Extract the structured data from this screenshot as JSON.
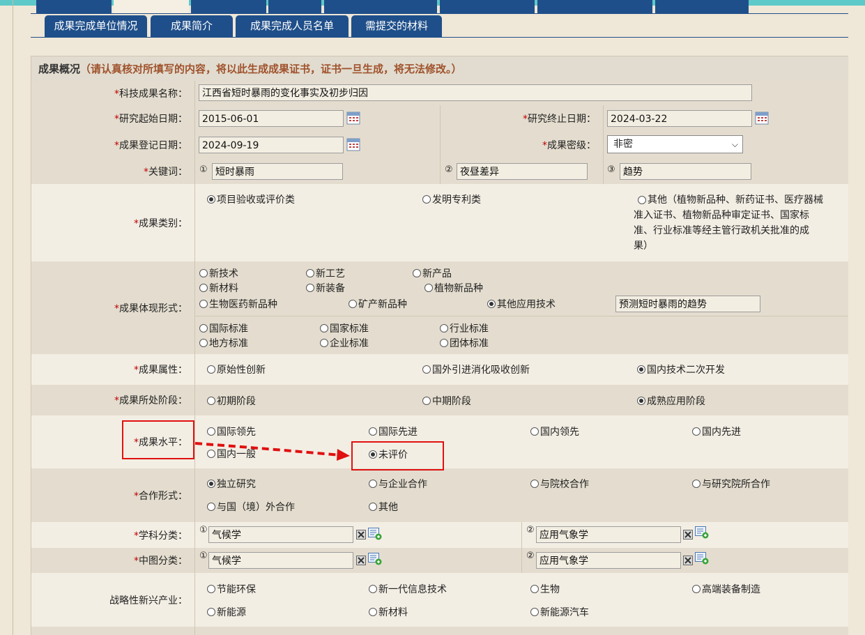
{
  "colors": {
    "tab_blue": "#1f4f8a",
    "accent_red": "#e01010",
    "warning_brown": "#a0522d",
    "top_strip": "#5ec9c9"
  },
  "sub_tabs": [
    {
      "label": "成果完成单位情况"
    },
    {
      "label": "成果简介"
    },
    {
      "label": "成果完成人员名单"
    },
    {
      "label": "需提交的材料"
    }
  ],
  "section": {
    "title": "成果概况",
    "notice": "（请认真核对所填写的内容，将以此生成成果证书，证书一旦生成，将无法修改。）"
  },
  "form": {
    "name": {
      "label": "科技成果名称：",
      "value": "江西省短时暴雨的变化事实及初步归因"
    },
    "start": {
      "label": "研究起始日期：",
      "value": "2015-06-01"
    },
    "end": {
      "label": "研究终止日期：",
      "value": "2024-03-22"
    },
    "reg": {
      "label": "成果登记日期：",
      "value": "2024-09-19"
    },
    "secret": {
      "label": "成果密级：",
      "value": "非密"
    },
    "keywords": {
      "label": "关键词：",
      "n1": "①",
      "n2": "②",
      "n3": "③",
      "k1": "短时暴雨",
      "k2": "夜昼差异",
      "k3": "趋势"
    },
    "category": {
      "label": "成果类别：",
      "o1": "项目验收或评价类",
      "o2": "发明专利类",
      "o3_l1": "其他（植物新品种、新药证书、医疗器械",
      "o3_l2": "准入证书、植物新品种审定证书、国家标",
      "o3_l3": "准、行业标准等经主管行政机关批准的成",
      "o3_l4": "果）"
    },
    "form_type": {
      "label": "成果体现形式：",
      "o1": "新技术",
      "o2": "新工艺",
      "o3": "新产品",
      "o4": "新材料",
      "o5": "新装备",
      "o6": "植物新品种",
      "o7": "生物医药新品种",
      "o8": "矿产新品种",
      "o9": "其他应用技术",
      "other_value": "预测短时暴雨的趋势",
      "s1": "国际标准",
      "s2": "国家标准",
      "s3": "行业标准",
      "s4": "地方标准",
      "s5": "企业标准",
      "s6": "团体标准"
    },
    "attribute": {
      "label": "成果属性：",
      "o1": "原始性创新",
      "o2": "国外引进消化吸收创新",
      "o3": "国内技术二次开发"
    },
    "stage": {
      "label": "成果所处阶段：",
      "o1": "初期阶段",
      "o2": "中期阶段",
      "o3": "成熟应用阶段"
    },
    "level": {
      "label": "成果水平：",
      "o1": "国际领先",
      "o2": "国际先进",
      "o3": "国内领先",
      "o4": "国内先进",
      "o5": "国内一般",
      "o6": "未评价"
    },
    "coop": {
      "label": "合作形式：",
      "o1": "独立研究",
      "o2": "与企业合作",
      "o3": "与院校合作",
      "o4": "与研究院所合作",
      "o5": "与国（境）外合作",
      "o6": "其他"
    },
    "subject": {
      "label": "学科分类：",
      "n1": "①",
      "n2": "②",
      "v1": "气候学",
      "v2": "应用气象学"
    },
    "clc": {
      "label": "中图分类：",
      "n1": "①",
      "n2": "②",
      "v1": "气候学",
      "v2": "应用气象学"
    },
    "industry": {
      "label": "战略性新兴产业：",
      "o1": "节能环保",
      "o2": "新一代信息技术",
      "o3": "生物",
      "o4": "高端装备制造",
      "o5": "新能源",
      "o6": "新材料",
      "o7": "新能源汽车"
    }
  }
}
